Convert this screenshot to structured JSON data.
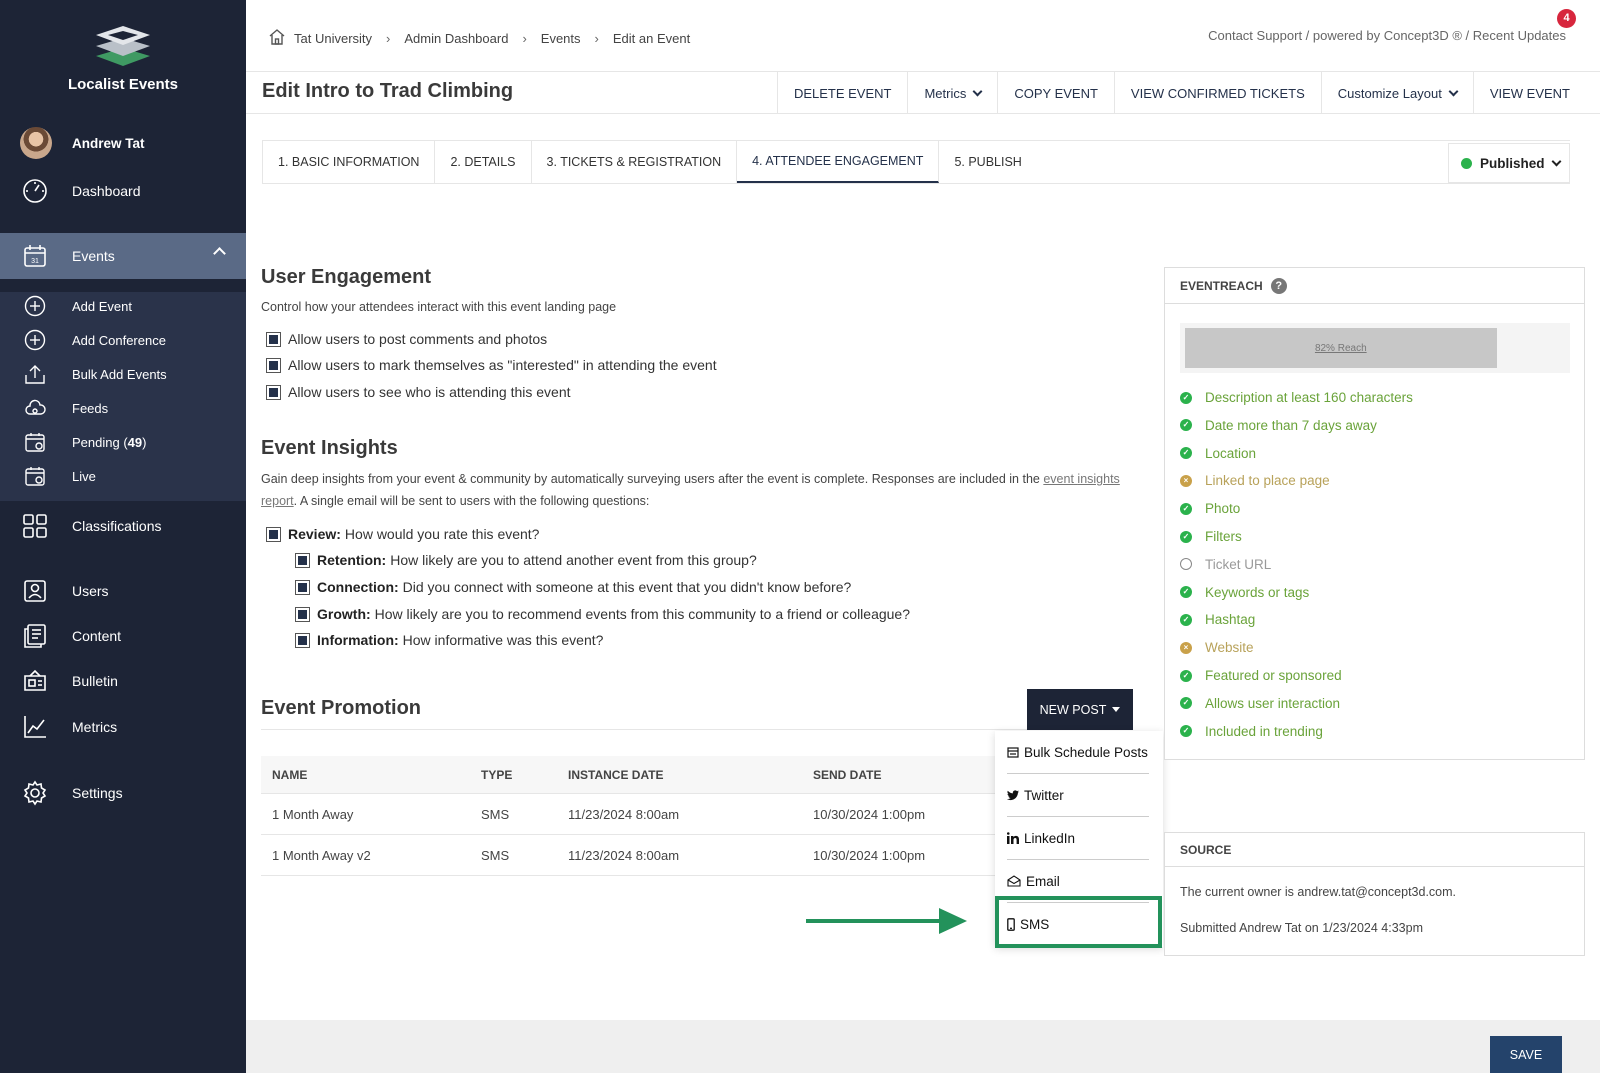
{
  "app": {
    "name": "Localist Events"
  },
  "user": {
    "name": "Andrew Tat"
  },
  "sidebar": {
    "dashboard": "Dashboard",
    "events": "Events",
    "events_sub": [
      {
        "label": "Add Event",
        "icon": "plus-circle-icon"
      },
      {
        "label": "Add Conference",
        "icon": "plus-circle-icon"
      },
      {
        "label": "Bulk Add Events",
        "icon": "upload-icon"
      },
      {
        "label": "Feeds",
        "icon": "cloud-icon"
      },
      {
        "label_prefix": "Pending (",
        "count": "49",
        "label_suffix": ")",
        "icon": "calendar-pending-icon"
      },
      {
        "label": "Live",
        "icon": "calendar-live-icon"
      }
    ],
    "classifications": "Classifications",
    "users": "Users",
    "content": "Content",
    "bulletin": "Bulletin",
    "metrics": "Metrics",
    "settings": "Settings"
  },
  "breadcrumbs": [
    "Tat University",
    "Admin Dashboard",
    "Events",
    "Edit an Event"
  ],
  "crumb_sep": "›",
  "support_links": "Contact Support / powered by Concept3D ® / Recent Updates",
  "notification_count": "4",
  "page_title": "Edit Intro to Trad Climbing",
  "actions": {
    "delete": "DELETE EVENT",
    "metrics": "Metrics",
    "copy": "COPY EVENT",
    "tickets": "VIEW CONFIRMED TICKETS",
    "customize": "Customize Layout",
    "view": "VIEW EVENT"
  },
  "tabs": [
    "1. BASIC INFORMATION",
    "2. DETAILS",
    "3. TICKETS & REGISTRATION",
    "4. ATTENDEE ENGAGEMENT",
    "5. PUBLISH"
  ],
  "active_tab": "4. ATTENDEE ENGAGEMENT",
  "publish_status": "Published",
  "user_engagement": {
    "title": "User Engagement",
    "desc": "Control how your attendees interact with this event landing page",
    "options": [
      "Allow users to post comments and photos",
      "Allow users to mark themselves as \"interested\" in attending the event",
      "Allow users to see who is attending this event"
    ]
  },
  "insights": {
    "title": "Event Insights",
    "desc_1": "Gain deep insights from your event & community by automatically surveying users after the event is complete. Responses are included in the ",
    "link_1": "event",
    "link_2": "insights report",
    "desc_2": ". A single email will be sent to users with the following questions:",
    "review": {
      "label": "Review:",
      "text": "How would you rate this event?"
    },
    "questions": [
      {
        "label": "Retention:",
        "text": "How likely are you to attend another event from this group?"
      },
      {
        "label": "Connection:",
        "text": "Did you connect with someone at this event that you didn't know before?"
      },
      {
        "label": "Growth:",
        "text": "How likely are you to recommend events from this community to a friend or colleague?"
      },
      {
        "label": "Information:",
        "text": "How informative was this event?"
      }
    ]
  },
  "promotion": {
    "title": "Event Promotion",
    "new_post": "NEW POST",
    "columns": [
      "NAME",
      "TYPE",
      "INSTANCE DATE",
      "SEND DATE"
    ],
    "rows": [
      [
        "1 Month Away",
        "SMS",
        "11/23/2024 8:00am",
        "10/30/2024 1:00pm"
      ],
      [
        "1 Month Away v2",
        "SMS",
        "11/23/2024 8:00am",
        "10/30/2024 1:00pm"
      ]
    ],
    "menu": [
      {
        "label": "Bulk Schedule Posts",
        "icon": "calendar-icon"
      },
      {
        "label": "Twitter",
        "icon": "twitter-icon"
      },
      {
        "label": "LinkedIn",
        "icon": "linkedin-icon"
      },
      {
        "label": "Email",
        "icon": "email-icon"
      },
      {
        "label": "SMS",
        "icon": "mobile-phone-icon"
      }
    ]
  },
  "eventreach": {
    "title": "EVENTREACH",
    "help": "?",
    "reach_label": "82% Reach",
    "reach_value": 0.82,
    "criteria": [
      {
        "label": "Description at least 160 characters",
        "status": "complete"
      },
      {
        "label": "Date more than 7 days away",
        "status": "complete"
      },
      {
        "label": "Location",
        "status": "complete"
      },
      {
        "label": "Linked to place page",
        "status": "warning"
      },
      {
        "label": "Photo",
        "status": "complete"
      },
      {
        "label": "Filters",
        "status": "complete"
      },
      {
        "label": "Ticket URL",
        "status": "empty"
      },
      {
        "label": "Keywords or tags",
        "status": "complete"
      },
      {
        "label": "Hashtag",
        "status": "complete"
      },
      {
        "label": "Website",
        "status": "warning"
      },
      {
        "label": "Featured or sponsored",
        "status": "complete"
      },
      {
        "label": "Allows user interaction",
        "status": "complete"
      },
      {
        "label": "Included in trending",
        "status": "complete"
      }
    ],
    "colors": {
      "complete": "#6aa33a",
      "warning": "#b8a25a",
      "empty": "#9a9a9a"
    }
  },
  "source": {
    "title": "SOURCE",
    "owner": "The current owner is andrew.tat@concept3d.com.",
    "submitted": "Submitted Andrew Tat on 1/23/2024 4:33pm"
  },
  "save_label": "SAVE"
}
